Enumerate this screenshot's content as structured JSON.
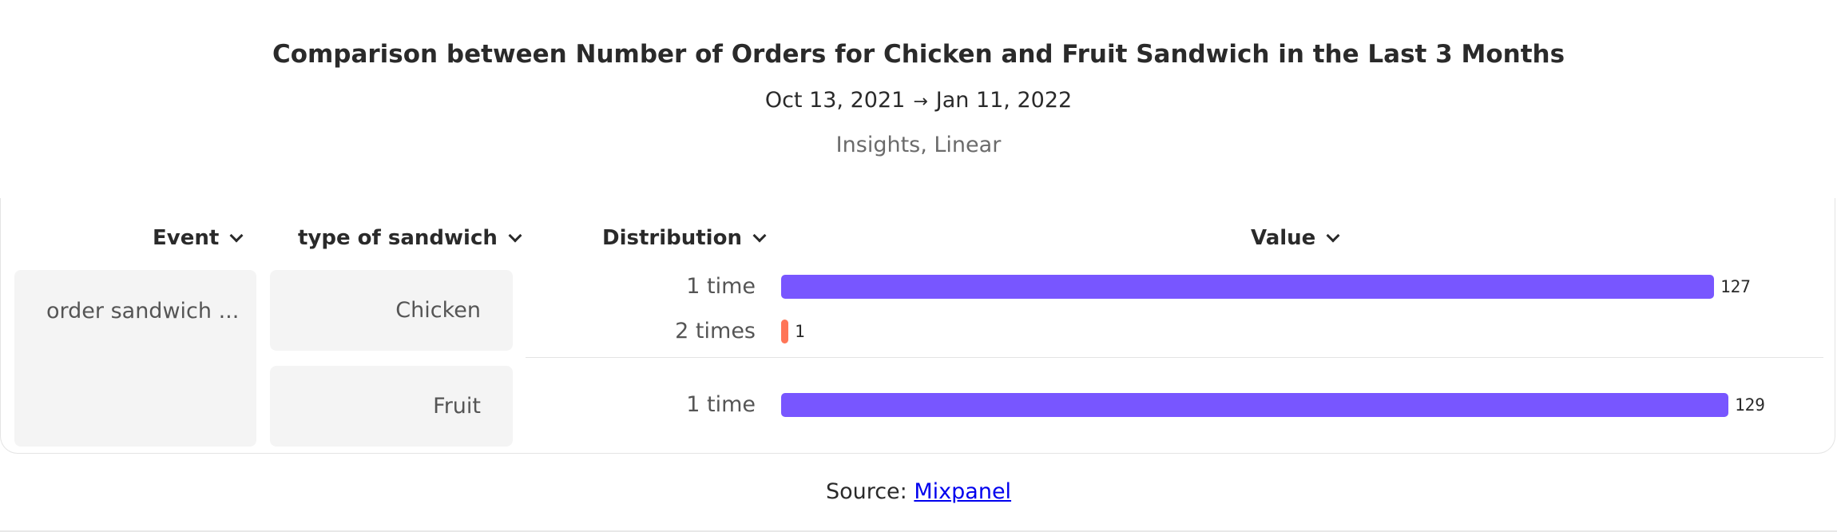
{
  "header": {
    "title": "Comparison between Number of Orders for Chicken and Fruit Sandwich in the Last 3 Months",
    "date_start": "Oct 13, 2021",
    "date_end": "Jan 11, 2022",
    "subtitle": "Insights, Linear"
  },
  "columns": {
    "event": "Event",
    "type": "type of sandwich",
    "distribution": "Distribution",
    "value": "Value"
  },
  "event_name": "order sandwich ...",
  "chart_data": {
    "type": "bar",
    "orientation": "horizontal",
    "title": "Comparison between Number of Orders for Chicken and Fruit Sandwich in the Last 3 Months",
    "groups": [
      {
        "name": "Chicken",
        "rows": [
          {
            "label": "1 time",
            "value": 127,
            "color": "#7856ff"
          },
          {
            "label": "2 times",
            "value": 1,
            "color": "#ff7557"
          }
        ]
      },
      {
        "name": "Fruit",
        "rows": [
          {
            "label": "1 time",
            "value": 129,
            "color": "#7856ff"
          }
        ]
      }
    ],
    "xlim": [
      0,
      129
    ],
    "grid": false,
    "legend": "none"
  },
  "footer": {
    "source_prefix": "Source:",
    "source_link": "Mixpanel"
  }
}
